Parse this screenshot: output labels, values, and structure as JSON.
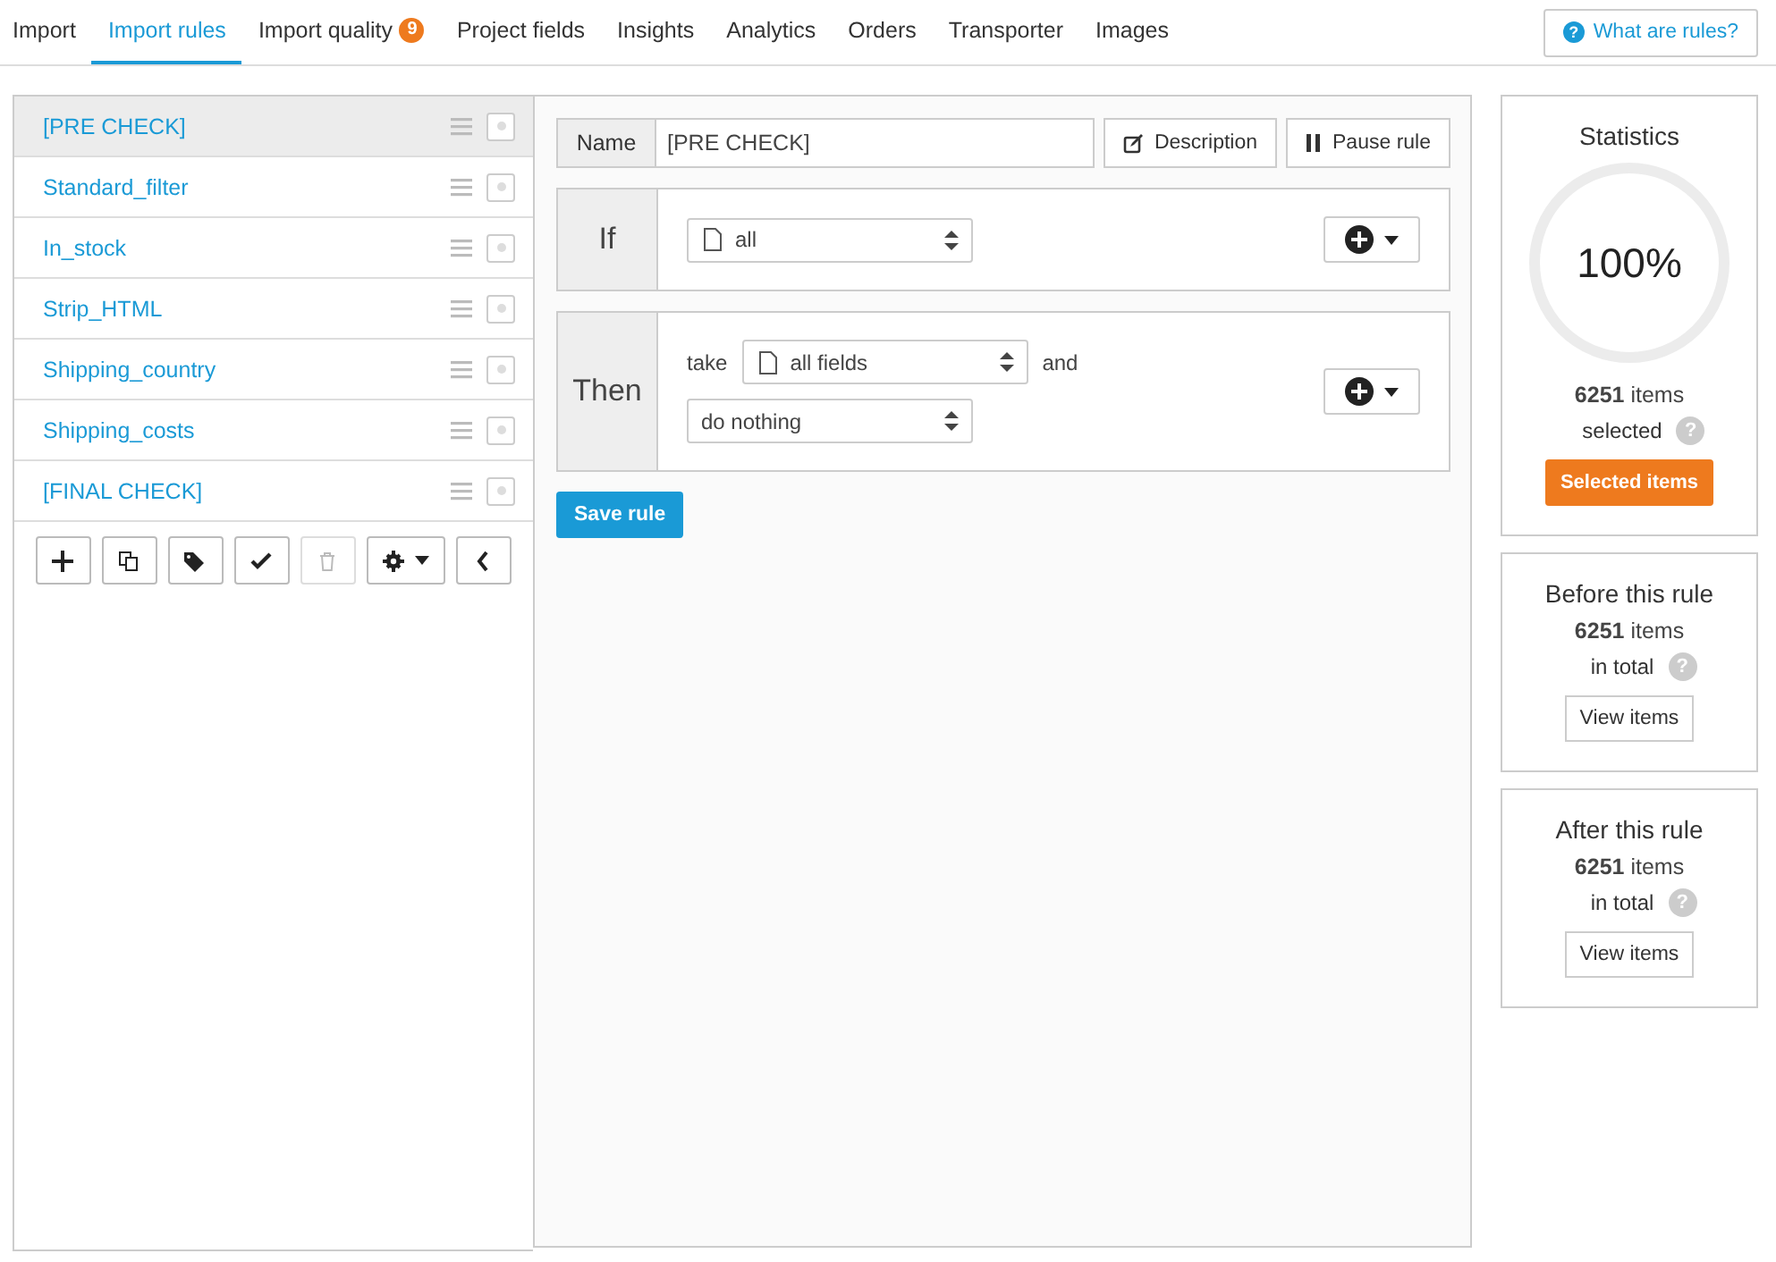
{
  "nav": {
    "tabs": [
      {
        "label": "Import",
        "selected": false
      },
      {
        "label": "Import rules",
        "selected": true
      },
      {
        "label": "Import quality",
        "selected": false,
        "badge": "9"
      },
      {
        "label": "Project fields",
        "selected": false
      },
      {
        "label": "Insights",
        "selected": false
      },
      {
        "label": "Analytics",
        "selected": false
      },
      {
        "label": "Orders",
        "selected": false
      },
      {
        "label": "Transporter",
        "selected": false
      },
      {
        "label": "Images",
        "selected": false
      }
    ],
    "help_icon": "?",
    "help_button": "What are rules?"
  },
  "rules": {
    "items": [
      {
        "label": "[PRE CHECK]",
        "selected": true
      },
      {
        "label": "Standard_filter",
        "selected": false
      },
      {
        "label": "In_stock",
        "selected": false
      },
      {
        "label": "Strip_HTML",
        "selected": false
      },
      {
        "label": "Shipping_country",
        "selected": false
      },
      {
        "label": "Shipping_costs",
        "selected": false
      },
      {
        "label": "[FINAL CHECK]",
        "selected": false
      }
    ],
    "toolbar": [
      {
        "kind": "add",
        "disabled": false
      },
      {
        "kind": "copy",
        "disabled": false
      },
      {
        "kind": "tags",
        "disabled": false
      },
      {
        "kind": "check",
        "disabled": false
      },
      {
        "kind": "delete",
        "disabled": true
      },
      {
        "kind": "settings",
        "disabled": false
      },
      {
        "kind": "collapse",
        "disabled": false
      }
    ]
  },
  "editor": {
    "name_label": "Name",
    "name_value": "[PRE CHECK]",
    "description_button": "Description",
    "pause_button": "Pause rule",
    "if": {
      "label": "If",
      "select": "all"
    },
    "then": {
      "label": "Then",
      "take": "take",
      "fields_select": "all fields",
      "and": "and",
      "action_select": "do nothing"
    },
    "save_button": "Save rule"
  },
  "statistics": {
    "title": "Statistics",
    "percent": "100%",
    "count": "6251",
    "count_unit": "items",
    "caption": "selected",
    "help_icon": "?",
    "button": "Selected items"
  },
  "before": {
    "title": "Before this rule",
    "count": "6251",
    "count_unit": "items",
    "caption": "in total",
    "help_icon": "?",
    "button": "View items"
  },
  "after": {
    "title": "After this rule",
    "count": "6251",
    "count_unit": "items",
    "caption": "in total",
    "help_icon": "?",
    "button": "View items"
  }
}
